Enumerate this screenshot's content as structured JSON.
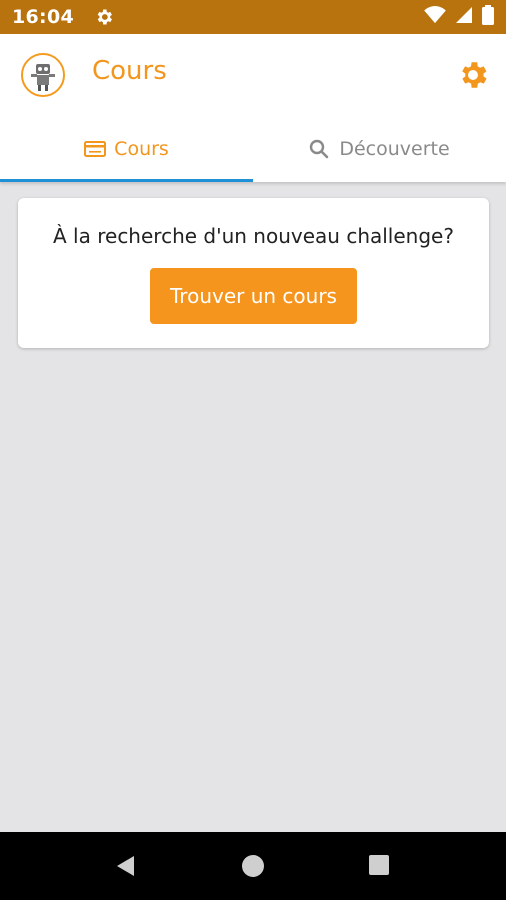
{
  "status_bar": {
    "time": "16:04"
  },
  "app_bar": {
    "title": "Cours"
  },
  "tabs": [
    {
      "label": "Cours",
      "icon": "card-icon",
      "active": true
    },
    {
      "label": "Découverte",
      "icon": "search-icon",
      "active": false
    }
  ],
  "card": {
    "prompt": "À la recherche d'un nouveau challenge?",
    "button_label": "Trouver un cours"
  },
  "colors": {
    "status_bar": "#b8730f",
    "accent": "#f2961d",
    "tab_indicator": "#1f8fd6",
    "background": "#e4e4e6"
  }
}
